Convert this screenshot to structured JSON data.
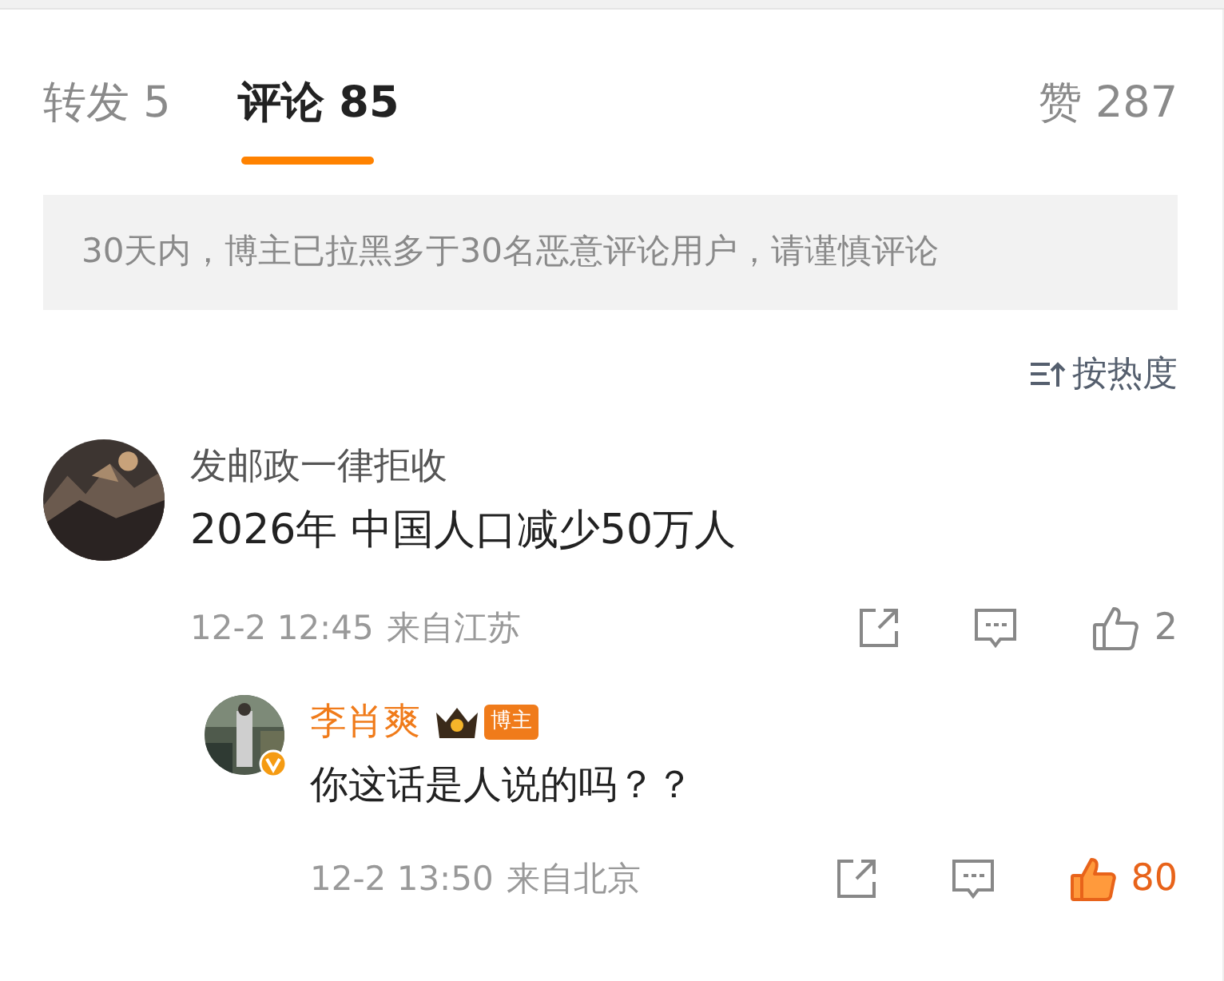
{
  "tabs": [
    {
      "label": "转发",
      "count": "5",
      "selected": false
    },
    {
      "label": "评论",
      "count": "85",
      "selected": true
    },
    {
      "label": "赞",
      "count": "287",
      "selected": false
    }
  ],
  "notice": "30天内，博主已拉黑多于30名恶意评论用户，请谨慎评论",
  "sort": {
    "label": "按热度"
  },
  "comments": [
    {
      "author": "发邮政一律拒收",
      "text": "2026年 中国人口减少50万人",
      "time": "12-2 12:45",
      "location": "来自江苏",
      "likes": "2",
      "liked": false,
      "replies": [
        {
          "author": "李肖爽",
          "badge": "博主",
          "text": "你这话是人说的吗？？",
          "time": "12-2 13:50",
          "location": "来自北京",
          "likes": "80",
          "liked": true,
          "verified": true
        }
      ]
    }
  ]
}
